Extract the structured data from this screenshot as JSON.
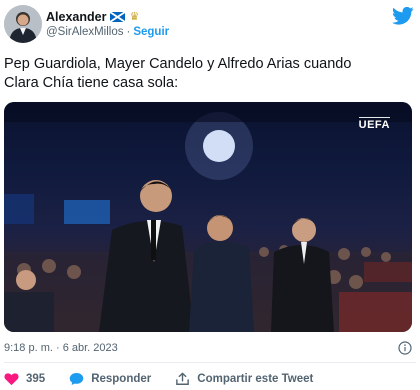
{
  "author": {
    "display_name": "Alexander",
    "handle": "@SirAlexMillos",
    "separator": "·",
    "follow_label": "Seguir",
    "avatar_icon": "person-avatar-icon",
    "badges": [
      "scotland-flag-icon",
      "crown-emoji-icon"
    ]
  },
  "tweet": {
    "lines": [
      "Pep Guardiola, Mayer Candelo y Alfredo Arias cuando",
      "Clara Chía tiene casa sola:"
    ]
  },
  "media": {
    "overlay_logo": "UEFA"
  },
  "meta": {
    "timestamp": "9:18 p. m. · 6 abr. 2023"
  },
  "actions": {
    "like_count": "395",
    "reply_label": "Responder",
    "share_label": "Compartir este Tweet"
  },
  "colors": {
    "brand": "#1d9bf0",
    "like": "#f91880",
    "text": "#0f1419",
    "muted": "#536471"
  }
}
